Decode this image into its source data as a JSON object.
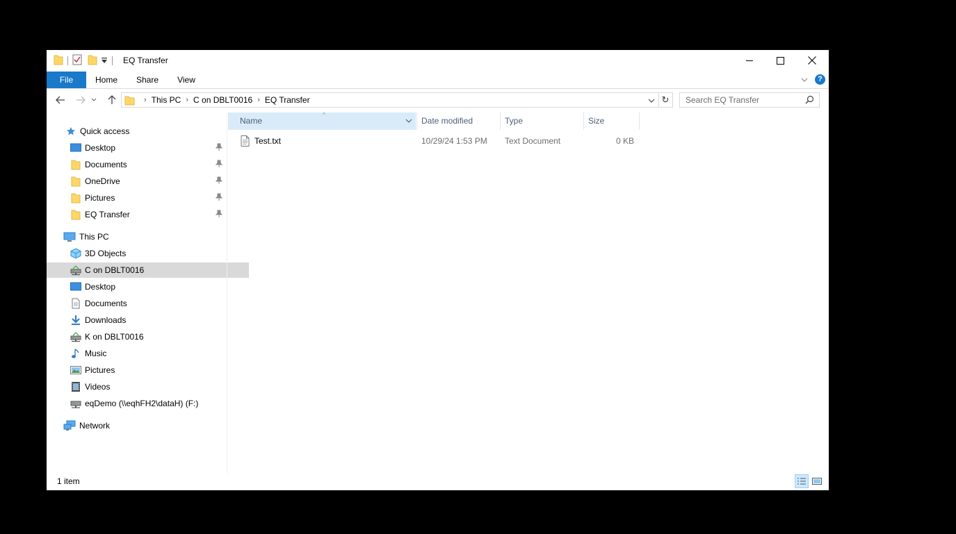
{
  "window": {
    "title": "EQ Transfer"
  },
  "ribbon": {
    "tabs": [
      "File",
      "Home",
      "Share",
      "View"
    ],
    "accent": "#1979ca"
  },
  "address": {
    "crumbs": [
      "This PC",
      "C on DBLT0016",
      "EQ Transfer"
    ]
  },
  "search": {
    "placeholder": "Search EQ Transfer"
  },
  "nav": {
    "quick_access": "Quick access",
    "quick_items": [
      "Desktop",
      "Documents",
      "OneDrive",
      "Pictures",
      "EQ Transfer"
    ],
    "this_pc": "This PC",
    "pc_items": [
      "3D Objects",
      "C on DBLT0016",
      "Desktop",
      "Documents",
      "Downloads",
      "K on DBLT0016",
      "Music",
      "Pictures",
      "Videos",
      "eqDemo (\\\\eqhFH2\\dataH) (F:)"
    ],
    "network": "Network",
    "selected": "C on DBLT0016"
  },
  "columns": [
    "Name",
    "Date modified",
    "Type",
    "Size"
  ],
  "files": [
    {
      "name": "Test.txt",
      "date": "10/29/24 1:53 PM",
      "type": "Text Document",
      "size": "0 KB"
    }
  ],
  "status": {
    "count": "1 item"
  },
  "icons": [
    "folder-icon",
    "properties-icon",
    "back-icon",
    "forward-icon",
    "recent-icon",
    "up-icon",
    "refresh-icon",
    "search-icon",
    "pin-icon",
    "star-icon",
    "monitor-icon",
    "network-drive-icon",
    "downloads-icon",
    "music-icon",
    "pictures-icon",
    "videos-icon",
    "network-icon",
    "text-file-icon",
    "details-view-icon",
    "large-icons-view-icon"
  ]
}
